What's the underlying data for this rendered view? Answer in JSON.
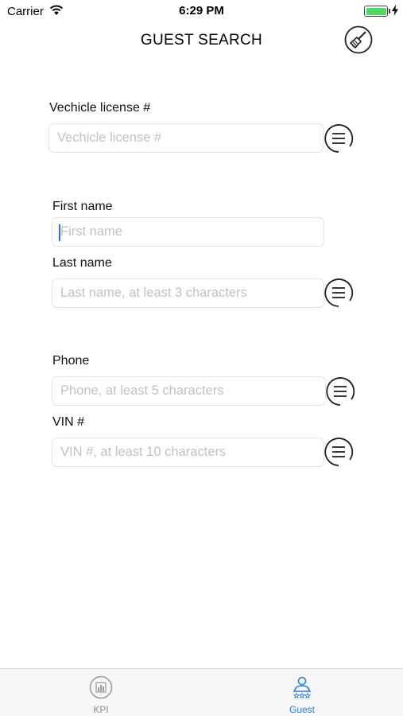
{
  "status_bar": {
    "carrier": "Carrier",
    "time": "6:29 PM"
  },
  "header": {
    "title": "GUEST SEARCH",
    "clear_icon": "broom-icon"
  },
  "form": {
    "vehicle_license": {
      "label": "Vechicle license #",
      "placeholder": "Vechicle license #"
    },
    "first_name": {
      "label": "First name",
      "placeholder": "First name"
    },
    "last_name": {
      "label": "Last name",
      "placeholder": "Last name, at least 3 characters"
    },
    "phone": {
      "label": "Phone",
      "placeholder": "Phone, at least 5 characters"
    },
    "vin": {
      "label": "VIN #",
      "placeholder": "VIN #, at least 10 characters"
    }
  },
  "tab_bar": {
    "tabs": [
      {
        "label": "KPI",
        "icon": "chart-icon",
        "active": false
      },
      {
        "label": "Guest",
        "icon": "guest-icon",
        "active": true
      }
    ],
    "active_color": "#2a7de1",
    "inactive_color": "#8e8e93"
  }
}
